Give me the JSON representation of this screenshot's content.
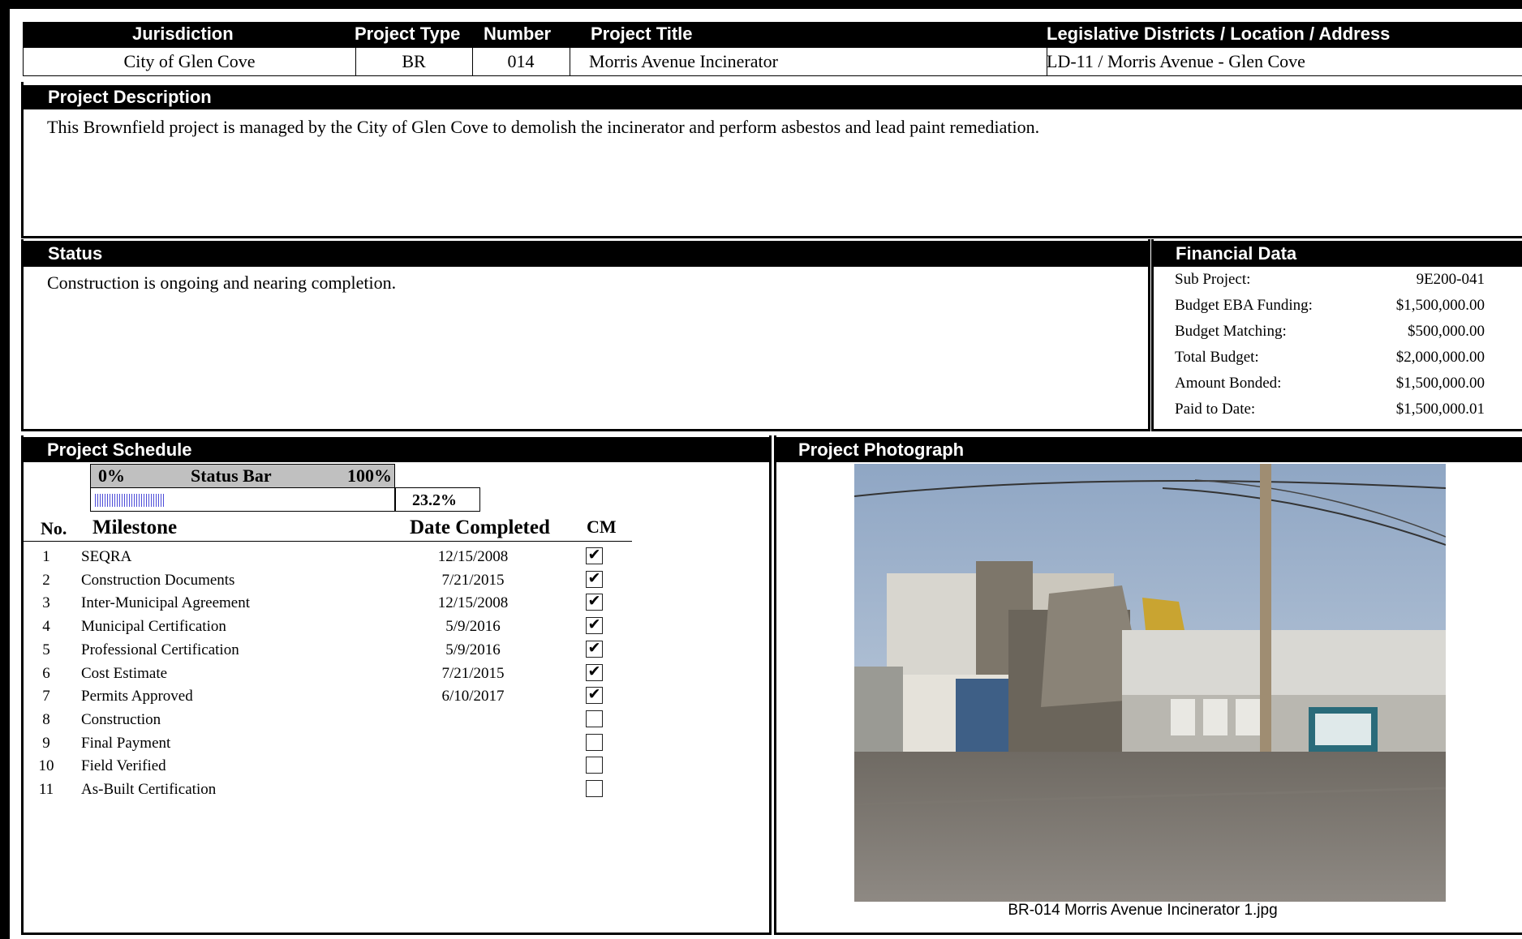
{
  "header": {
    "columns": {
      "jurisdiction": "Jurisdiction",
      "project_type": "Project Type",
      "number": "Number",
      "project_title": "Project Title",
      "location": "Legislative Districts / Location / Address"
    },
    "values": {
      "jurisdiction": "City of Glen Cove",
      "project_type": "BR",
      "number": "014",
      "project_title": "Morris Avenue Incinerator",
      "location": "LD-11 / Morris Avenue - Glen Cove"
    }
  },
  "description": {
    "title": "Project Description",
    "text": "This Brownfield project is managed by the City of Glen Cove to demolish the incinerator and perform asbestos and lead paint remediation."
  },
  "status": {
    "title": "Status",
    "text": "Construction is ongoing and nearing completion."
  },
  "financial": {
    "title": "Financial Data",
    "rows": [
      {
        "label": "Sub Project:",
        "value": "9E200-041"
      },
      {
        "label": "Budget EBA Funding:",
        "value": "$1,500,000.00"
      },
      {
        "label": "Budget Matching:",
        "value": "$500,000.00"
      },
      {
        "label": "Total Budget:",
        "value": "$2,000,000.00"
      },
      {
        "label": "Amount Bonded:",
        "value": "$1,500,000.00"
      },
      {
        "label": "Paid to Date:",
        "value": "$1,500,000.01"
      }
    ]
  },
  "schedule": {
    "title": "Project Schedule",
    "status_bar": {
      "min_label": "0%",
      "label": "Status Bar",
      "max_label": "100%",
      "value_label": "23.2%",
      "fraction": 0.232
    },
    "columns": {
      "no": "No.",
      "milestone": "Milestone",
      "date": "Date Completed",
      "cm": "CM"
    },
    "milestones": [
      {
        "no": "1",
        "name": "SEQRA",
        "date": "12/15/2008",
        "cm": true
      },
      {
        "no": "2",
        "name": "Construction Documents",
        "date": "7/21/2015",
        "cm": true
      },
      {
        "no": "3",
        "name": "Inter-Municipal Agreement",
        "date": "12/15/2008",
        "cm": true
      },
      {
        "no": "4",
        "name": "Municipal Certification",
        "date": "5/9/2016",
        "cm": true
      },
      {
        "no": "5",
        "name": "Professional Certification",
        "date": "5/9/2016",
        "cm": true
      },
      {
        "no": "6",
        "name": "Cost Estimate",
        "date": "7/21/2015",
        "cm": true
      },
      {
        "no": "7",
        "name": "Permits Approved",
        "date": "6/10/2017",
        "cm": true
      },
      {
        "no": "8",
        "name": "Construction",
        "date": "",
        "cm": false
      },
      {
        "no": "9",
        "name": "Final Payment",
        "date": "",
        "cm": false
      },
      {
        "no": "10",
        "name": "Field Verified",
        "date": "",
        "cm": false
      },
      {
        "no": "11",
        "name": "As-Built Certification",
        "date": "",
        "cm": false
      }
    ]
  },
  "photo": {
    "title": "Project Photograph",
    "caption": "BR-014 Morris Avenue Incinerator 1.jpg"
  }
}
